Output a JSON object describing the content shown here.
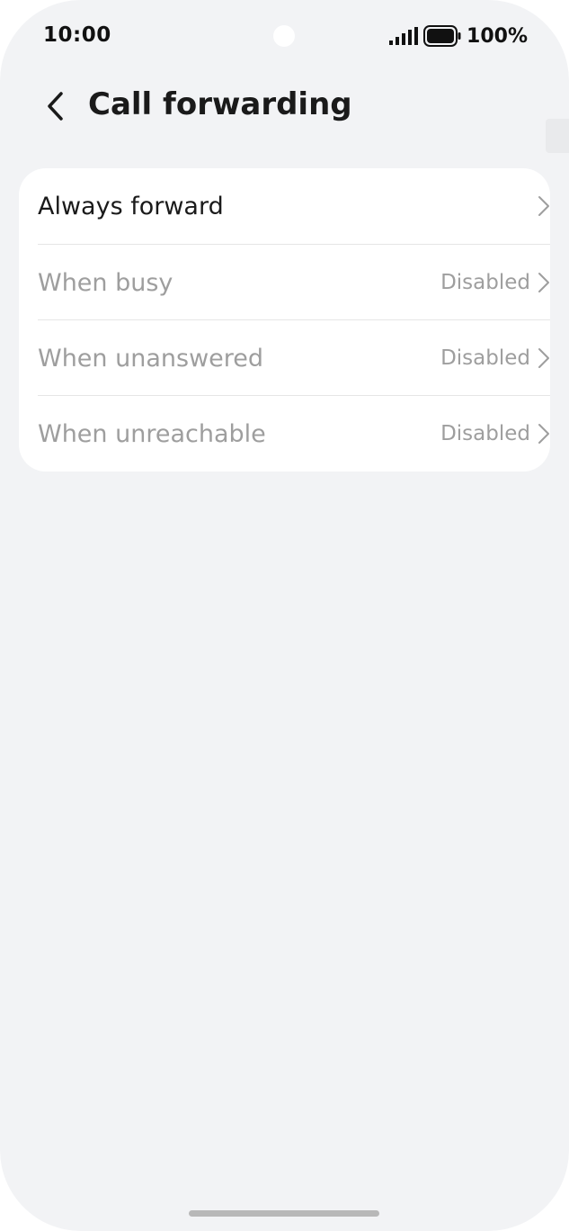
{
  "status_bar": {
    "time": "10:00",
    "battery": "100%",
    "icons": [
      "signal-icon",
      "battery-icon"
    ]
  },
  "header": {
    "title": "Call forwarding",
    "back_icon": "chevron-left-icon"
  },
  "options": [
    {
      "label": "Always forward",
      "value": "",
      "enabled": true
    },
    {
      "label": "When busy",
      "value": "Disabled",
      "enabled": false
    },
    {
      "label": "When unanswered",
      "value": "Disabled",
      "enabled": false
    },
    {
      "label": "When unreachable",
      "value": "Disabled",
      "enabled": false
    }
  ],
  "colors": {
    "background": "#f2f3f5",
    "card": "#ffffff",
    "text_primary": "#1a1a1a",
    "text_disabled": "#9e9e9e"
  }
}
